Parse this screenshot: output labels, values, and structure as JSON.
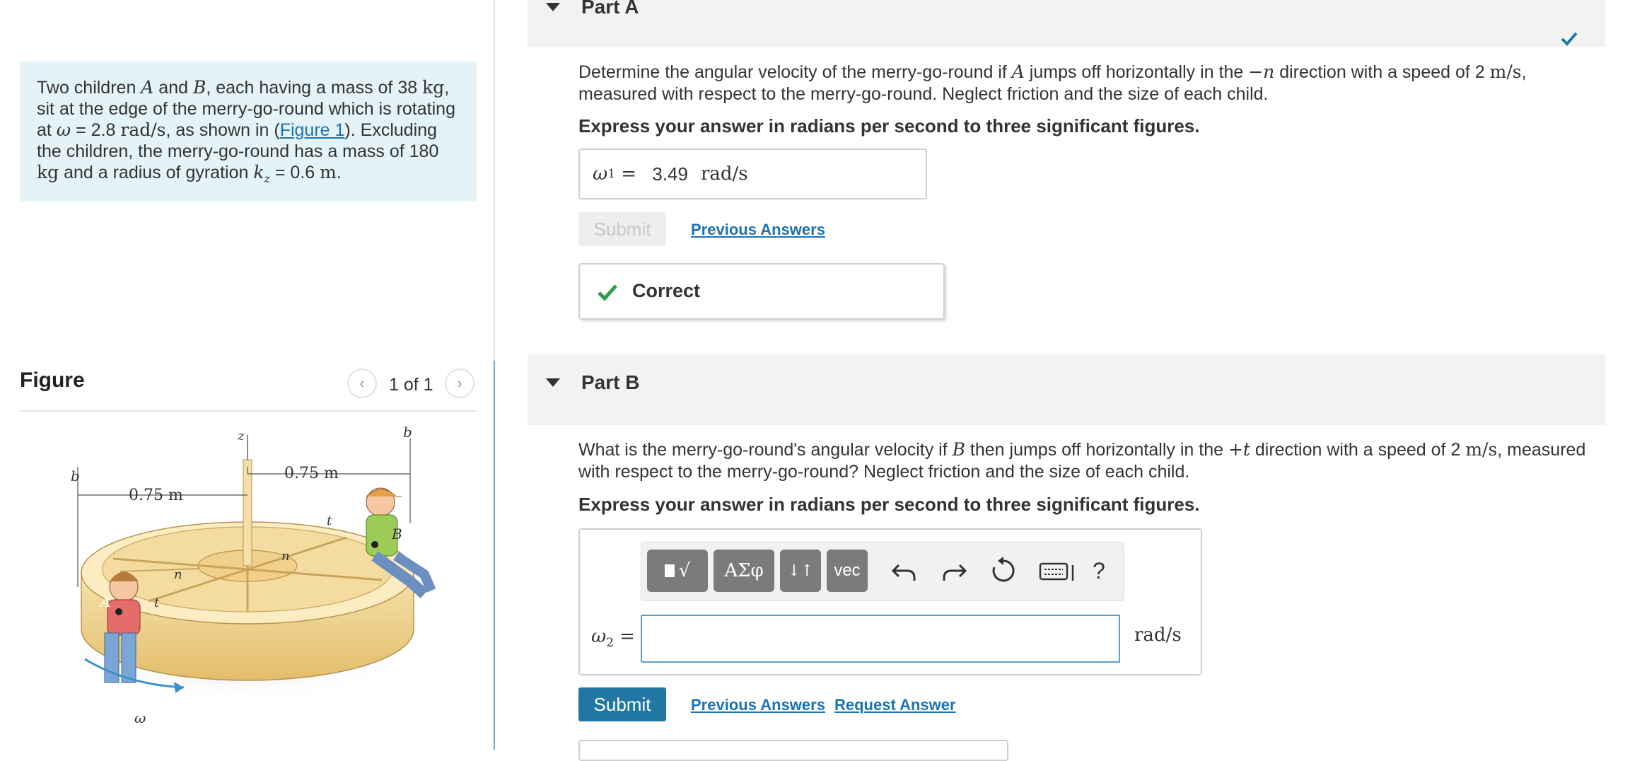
{
  "problem": {
    "t1": "Two children ",
    "A": "A",
    "t2": " and ",
    "B": "B",
    "t3": ", each having a mass of 38 ",
    "kg": "kg",
    "t4": ", sit at the edge of the merry-go-round which is rotating at ",
    "omega": "ω",
    "t5": " = 2.8 ",
    "rads": "rad/s",
    "t6": ", as shown in (",
    "figure_link": "Figure 1",
    "t7": "). Excluding the children, the merry-go-round has a mass of 180 ",
    "kg2": "kg",
    "t8": " and a radius of gyration ",
    "kz": "k",
    "kz_sub": "z",
    "t9": " = 0.6 ",
    "m": "m",
    "t10": "."
  },
  "figure": {
    "title": "Figure",
    "counter": "1 of 1",
    "prev_glyph": "‹",
    "next_glyph": "›",
    "labels": {
      "z": "z",
      "b_left": "b",
      "b_right": "b",
      "dim_left": "0.75 m",
      "dim_right": "0.75 m",
      "n_left": "n",
      "n_mid": "n",
      "t_left": "t",
      "t_right": "t",
      "A": "A",
      "B": "B",
      "omega": "ω"
    }
  },
  "partA": {
    "title": "Part A",
    "question": {
      "q1": "Determine the angular velocity of the merry-go-round if ",
      "A": "A",
      "q2": " jumps off horizontally in the ",
      "dir": "−n",
      "q3": " direction with a speed of 2 ",
      "speed_unit": "m/s",
      "q4": ", measured with respect to the merry-go-round. Neglect friction and the size of each child."
    },
    "instruction": "Express your answer in radians per second to three significant figures.",
    "answer_symbol": "ω",
    "answer_sub": "1",
    "answer_eq": " = ",
    "answer_value": "3.49",
    "answer_unit": "rad/s",
    "submit_label": "Submit",
    "previous_answers": "Previous Answers",
    "feedback": "Correct"
  },
  "partB": {
    "title": "Part B",
    "question": {
      "q1": "What is the merry-go-round's angular velocity if ",
      "B": "B",
      "q2": " then jumps off horizontally in the ",
      "dir": "+t",
      "q3": " direction with a speed of 2 ",
      "speed_unit": "m/s",
      "q4": ", measured with respect to the merry-go-round? Neglect friction and the size of each child."
    },
    "instruction": "Express your answer in radians per second to three significant figures.",
    "toolbar": {
      "templates": "√",
      "greek": "ΑΣφ",
      "arrows": "↓↑",
      "vec": "vec",
      "help": "?"
    },
    "answer_symbol": "ω",
    "answer_sub": "2",
    "answer_eq": " =",
    "answer_value": "",
    "answer_unit": "rad/s",
    "submit_label": "Submit",
    "previous_answers": "Previous Answers",
    "request_answer": "Request Answer"
  },
  "colors": {
    "accent": "#1b73b3",
    "submit_active": "#2077a4",
    "correct_green": "#2a9d4a",
    "problem_bg": "#e4f3f7",
    "part_header_bg": "#f2f2f2"
  }
}
